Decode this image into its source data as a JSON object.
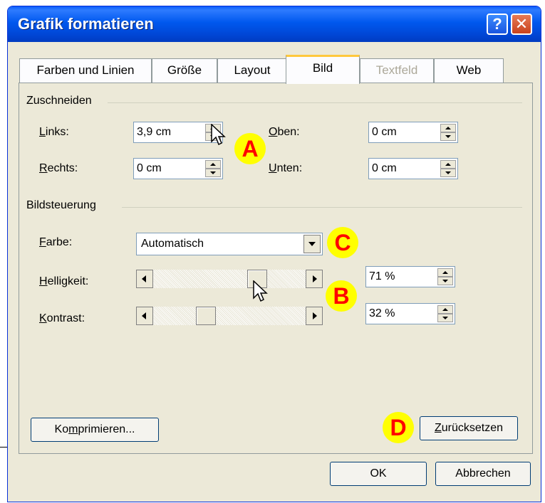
{
  "window": {
    "title": "Grafik formatieren",
    "help_label": "?",
    "close_label": "✕"
  },
  "tabs": [
    {
      "label": "Farben und Linien"
    },
    {
      "label": "Größe"
    },
    {
      "label": "Layout"
    },
    {
      "label": "Bild",
      "active": true
    },
    {
      "label": "Textfeld",
      "disabled": true
    },
    {
      "label": "Web"
    }
  ],
  "crop": {
    "group_label": "Zuschneiden",
    "left_label_mnemonic": "L",
    "left_label_rest": "inks:",
    "left_value": "3,9 cm",
    "right_label_mnemonic": "R",
    "right_label_rest": "echts:",
    "right_value": "0 cm",
    "top_label_mnemonic": "O",
    "top_label_rest": "ben:",
    "top_value": "0 cm",
    "bottom_label_mnemonic": "U",
    "bottom_label_rest": "nten:",
    "bottom_value": "0 cm"
  },
  "image_control": {
    "group_label": "Bildsteuerung",
    "color_label_mnemonic": "F",
    "color_label_rest": "arbe:",
    "color_value": "Automatisch",
    "brightness_label_mnemonic": "H",
    "brightness_label_rest": "elligkeit:",
    "brightness_value": "71 %",
    "brightness_level": 0.71,
    "contrast_label_mnemonic": "K",
    "contrast_label_rest": "ontrast:",
    "contrast_value": "32 %",
    "contrast_level": 0.32
  },
  "buttons": {
    "compress_pre": "Ko",
    "compress_mnemonic": "m",
    "compress_post": "primieren...",
    "reset_mnemonic": "Z",
    "reset_rest": "urücksetzen",
    "ok": "OK",
    "cancel": "Abbrechen"
  },
  "markers": {
    "a": "A",
    "b": "B",
    "c": "C",
    "d": "D"
  },
  "colors": {
    "titlebar": "#0058ee",
    "dialog_bg": "#ece9d8",
    "tab_highlight": "#ffc83c",
    "marker_bg": "#ffff00",
    "marker_text": "#ff0000"
  }
}
